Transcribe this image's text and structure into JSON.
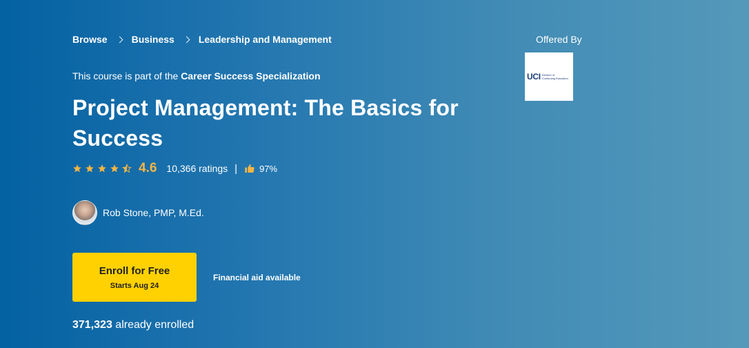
{
  "breadcrumb": {
    "items": [
      "Browse",
      "Business",
      "Leadership and Management"
    ]
  },
  "specialization": {
    "prefix": "This course is part of the ",
    "link": "Career Success Specialization"
  },
  "course": {
    "title": "Project Management: The Basics for Success",
    "rating": "4.6",
    "rating_stars": 4.5,
    "ratings_count": "10,366 ratings",
    "divider": "|",
    "like_percent": "97%",
    "instructor": "Rob Stone, PMP, M.Ed.",
    "enrolled_count": "371,323",
    "enrolled_suffix": " already enrolled"
  },
  "enroll": {
    "label": "Enroll for Free",
    "starts": "Starts Aug 24"
  },
  "financial_aid": "Financial aid available",
  "offered_by": {
    "label": "Offered By",
    "logo_mark": "UCI",
    "logo_line1": "Division of",
    "logo_line2": "Continuing Education"
  },
  "colors": {
    "accent_yellow": "#ffd100",
    "rating_orange": "#f5b545",
    "background_start": "#0461a2",
    "background_end": "#5599ba"
  },
  "icons": {
    "star": "star-icon",
    "half_star": "half-star-icon",
    "thumb": "thumbs-up-icon",
    "chevron": "chevron-right-icon"
  }
}
